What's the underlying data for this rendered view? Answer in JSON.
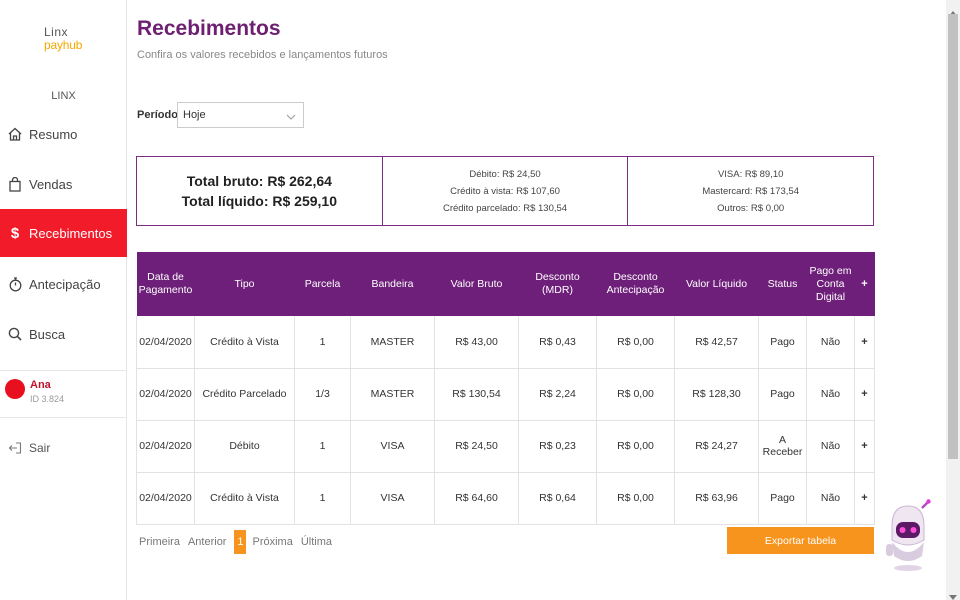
{
  "brand": {
    "line1": "Linx",
    "line2": "payhub"
  },
  "company": "LINX",
  "nav": [
    {
      "label": "Resumo",
      "icon": "home-icon"
    },
    {
      "label": "Vendas",
      "icon": "shopping-bag-icon"
    },
    {
      "label": "Recebimentos",
      "icon": "dollar-icon"
    },
    {
      "label": "Antecipação",
      "icon": "stopwatch-icon"
    },
    {
      "label": "Busca",
      "icon": "search-icon"
    }
  ],
  "user": {
    "name": "Ana",
    "id": "ID 3.824"
  },
  "logout": "Sair",
  "page": {
    "title": "Recebimentos",
    "subtitle": "Confira os valores recebidos e lançamentos futuros"
  },
  "period": {
    "label": "Período",
    "value": "Hoje"
  },
  "summary": {
    "total_bruto": "Total bruto: R$ 262,64",
    "total_liquido": "Total líquido: R$ 259,10",
    "debito": "Débito: R$ 24,50",
    "credito_vista": "Crédito à vista: R$ 107,60",
    "credito_parcelado": "Crédito parcelado: R$ 130,54",
    "visa": "VISA: R$ 89,10",
    "mastercard": "Mastercard: R$ 173,54",
    "outros": "Outros: R$ 0,00"
  },
  "table": {
    "headers": [
      "Data de Pagamento",
      "Tipo",
      "Parcela",
      "Bandeira",
      "Valor Bruto",
      "Desconto (MDR)",
      "Desconto Antecipação",
      "Valor Líquido",
      "Status",
      "Pago em Conta Digital",
      "+"
    ],
    "rows": [
      [
        "02/04/2020",
        "Crédito à Vista",
        "1",
        "MASTER",
        "R$ 43,00",
        "R$ 0,43",
        "R$ 0,00",
        "R$ 42,57",
        "Pago",
        "Não",
        "+"
      ],
      [
        "02/04/2020",
        "Crédito Parcelado",
        "1/3",
        "MASTER",
        "R$ 130,54",
        "R$ 2,24",
        "R$ 0,00",
        "R$ 128,30",
        "Pago",
        "Não",
        "+"
      ],
      [
        "02/04/2020",
        "Débito",
        "1",
        "VISA",
        "R$ 24,50",
        "R$ 0,23",
        "R$ 0,00",
        "R$ 24,27",
        "A Receber",
        "Não",
        "+"
      ],
      [
        "02/04/2020",
        "Crédito à Vista",
        "1",
        "VISA",
        "R$ 64,60",
        "R$ 0,64",
        "R$ 0,00",
        "R$ 63,96",
        "Pago",
        "Não",
        "+"
      ]
    ]
  },
  "pagination": {
    "first": "Primeira",
    "prev": "Anterior",
    "current": "1",
    "next": "Próxima",
    "last": "Última"
  },
  "export_label": "Exportar tabela",
  "colors": {
    "brand_purple": "#6e1f79",
    "active_red": "#f21b2a",
    "accent_orange": "#f7941d"
  }
}
